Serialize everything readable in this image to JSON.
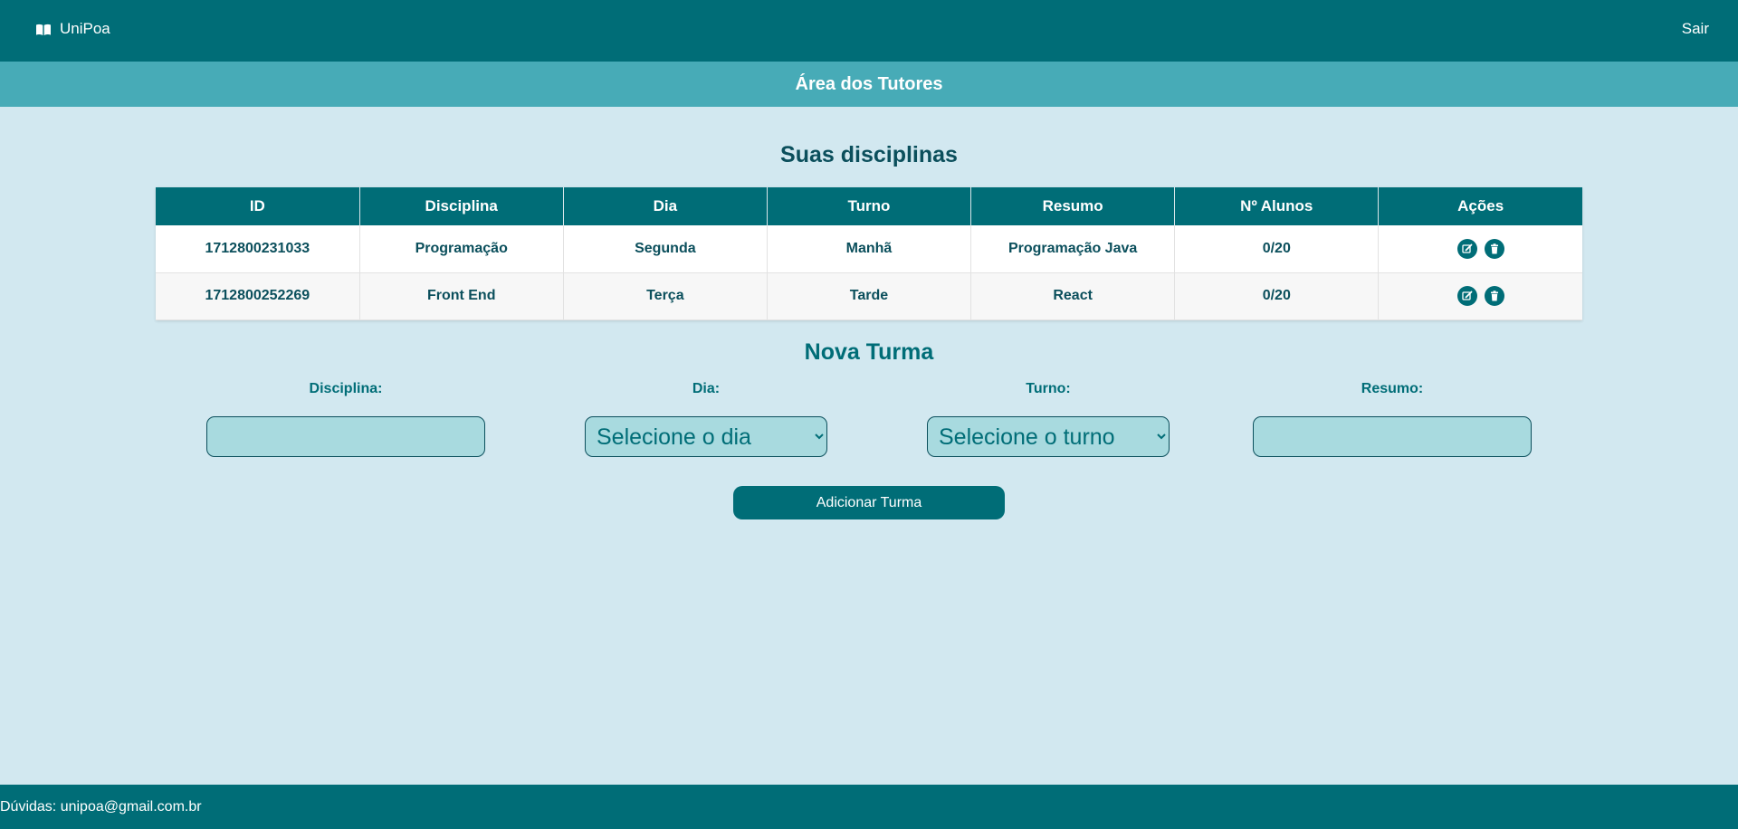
{
  "header": {
    "brand": "UniPoa",
    "brand_icon": "book-icon",
    "logout_label": "Sair"
  },
  "subheader": {
    "title": "Área dos Tutores"
  },
  "disciplines": {
    "title": "Suas disciplinas",
    "columns": [
      "ID",
      "Disciplina",
      "Dia",
      "Turno",
      "Resumo",
      "Nº Alunos",
      "Ações"
    ],
    "rows": [
      {
        "id": "1712800231033",
        "disciplina": "Programação",
        "dia": "Segunda",
        "turno": "Manhã",
        "resumo": "Programação Java",
        "alunos": "0/20"
      },
      {
        "id": "1712800252269",
        "disciplina": "Front End",
        "dia": "Terça",
        "turno": "Tarde",
        "resumo": "React",
        "alunos": "0/20"
      }
    ],
    "action_icons": [
      "edit-icon",
      "trash-icon"
    ]
  },
  "new_class": {
    "title": "Nova Turma",
    "disciplina_label": "Disciplina:",
    "disciplina_value": "",
    "dia_label": "Dia:",
    "dia_selected": "Selecione o dia",
    "turno_label": "Turno:",
    "turno_selected": "Selecione o turno",
    "resumo_label": "Resumo:",
    "resumo_value": "",
    "submit_label": "Adicionar Turma"
  },
  "footer": {
    "text": "Dúvidas: unipoa@gmail.com.br"
  },
  "colors": {
    "primary": "#006d77",
    "secondary": "#47abb7",
    "background": "#d2e8f0",
    "input_bg": "#a8dadf"
  }
}
